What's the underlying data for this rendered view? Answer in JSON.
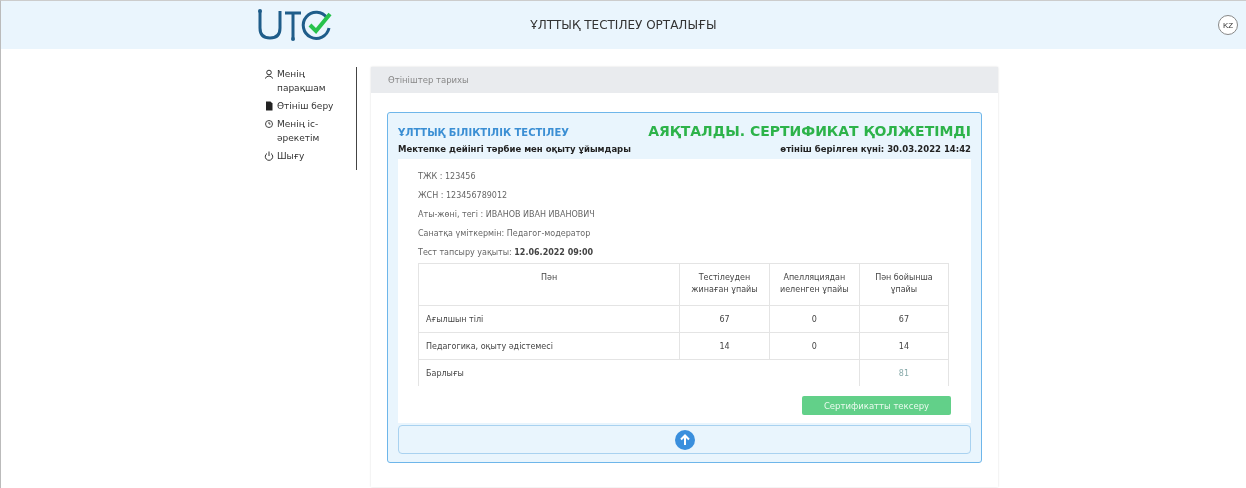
{
  "header": {
    "title": "ҰЛТТЫҚ ТЕСТІЛЕУ ОРТАЛЫҒЫ",
    "language": "KZ"
  },
  "sidebar": {
    "items": [
      {
        "kind": "user",
        "label": "Менің парақшам"
      },
      {
        "kind": "document",
        "label": "Өтініш беру"
      },
      {
        "kind": "history",
        "label": "Менің іс-әрекетім"
      },
      {
        "kind": "power",
        "label": "Шығу"
      }
    ]
  },
  "panel": {
    "title": "Өтініштер тарихы"
  },
  "application": {
    "test_name": "ҰЛТТЫҚ БІЛІКТІЛІК ТЕСТІЛЕУ",
    "status": "АЯҚТАЛДЫ. СЕРТИФИКАТ ҚОЛЖЕТІМДІ",
    "category": "Мектепке дейінгі тәрбие мен оқыту ұйымдары",
    "submitted": "өтініш берілген күні: 30.03.2022 14:42",
    "fields": [
      {
        "label": "ТЖК :",
        "value": "123456",
        "bold": false
      },
      {
        "label": "ЖСН :",
        "value": "123456789012",
        "bold": false
      },
      {
        "label": "Аты-жөні, тегі :",
        "value": "ИВАНОВ ИВАН ИВАНОВИЧ",
        "bold": false
      },
      {
        "label": "Санатқа үміткермін: Педагог-модератор"
      },
      {
        "label": "Тест тапсыру уақыты:",
        "value": "12.06.2022 09:00",
        "bold": true
      }
    ],
    "table": {
      "columns": [
        "Пән",
        "Тестілеуден жинаған ұпайы",
        "Апелляциядан иеленген ұпайы",
        "Пән бойынша ұпайы"
      ],
      "rows": [
        [
          "Ағылшын тілі",
          "67",
          "0",
          "67"
        ],
        [
          "Педагогика, оқыту әдістемесі",
          "14",
          "0",
          "14"
        ]
      ],
      "total": {
        "label": "Барлығы",
        "value": "81"
      }
    },
    "button": "Сертификатты тексеру"
  }
}
